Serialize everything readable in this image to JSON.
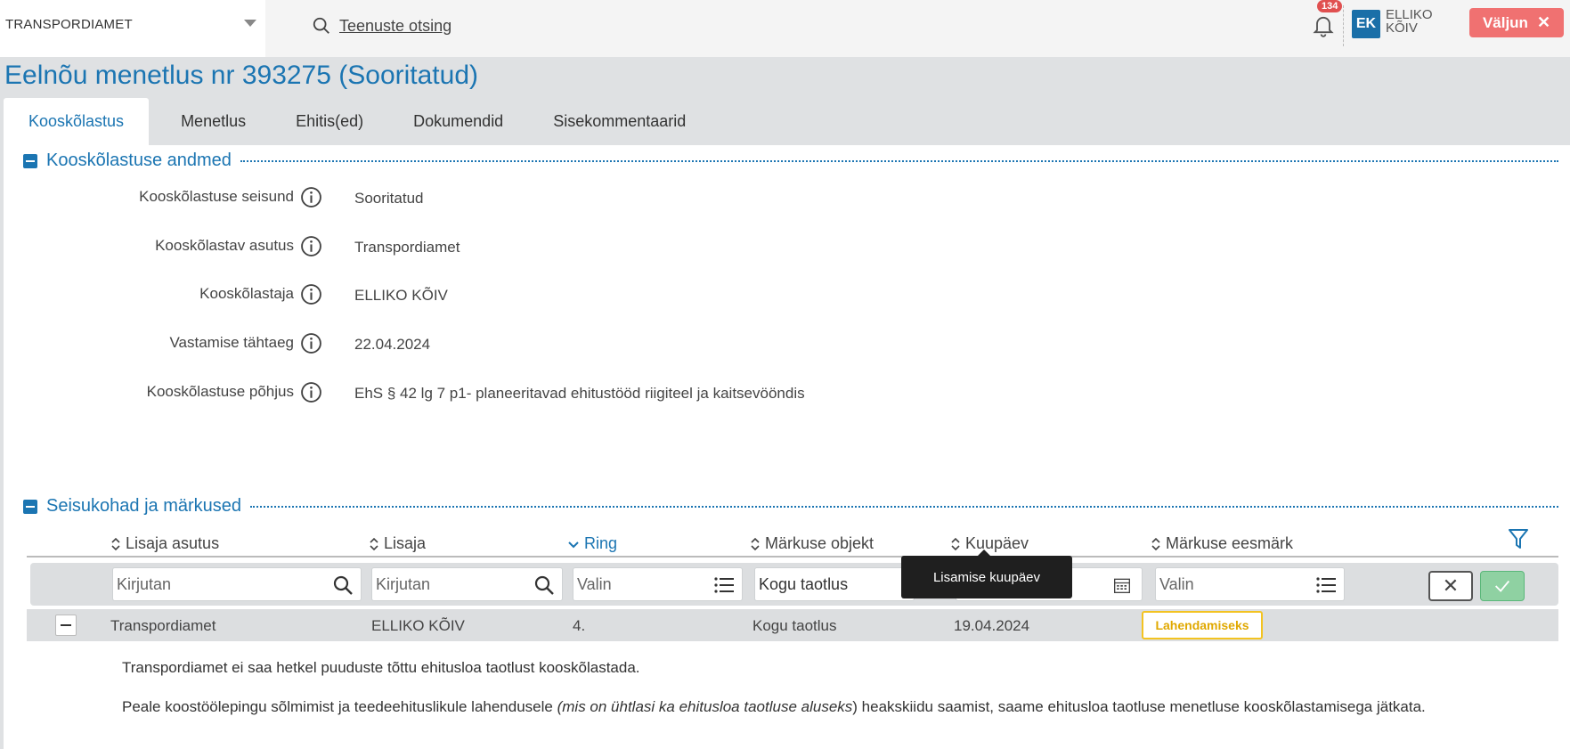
{
  "topbar": {
    "org_select": "TRANSPORDIAMET",
    "search_label": "Teenuste otsing",
    "notification_count": "134",
    "avatar_initials": "EK",
    "user_first": "ELLIKO",
    "user_last": "KÕIV",
    "logout_label": "Väljun"
  },
  "page_title": "Eelnõu menetlus nr 393275 (Sooritatud)",
  "tabs": [
    "Kooskõlastus",
    "Menetlus",
    "Ehitis(ed)",
    "Dokumendid",
    "Sisekommentaarid"
  ],
  "section1": {
    "title": "Kooskõlastuse andmed",
    "fields": [
      {
        "label": "Kooskõlastuse seisund",
        "value": "Sooritatud"
      },
      {
        "label": "Kooskõlastav asutus",
        "value": "Transpordiamet"
      },
      {
        "label": "Kooskõlastaja",
        "value": "ELLIKO KÕIV"
      },
      {
        "label": "Vastamise tähtaeg",
        "value": "22.04.2024"
      },
      {
        "label": "Kooskõlastuse põhjus",
        "value": "EhS § 42 lg 7 p1- planeeritavad ehitustööd riigiteel ja kaitsevööndis"
      }
    ]
  },
  "section2": {
    "title": "Seisukohad ja märkused",
    "columns": [
      "Lisaja asutus",
      "Lisaja",
      "Ring",
      "Märkuse objekt",
      "Kuupäev",
      "Märkuse eesmärk"
    ],
    "filters": {
      "lisaja_asutus": "Kirjutan",
      "lisaja": "Kirjutan",
      "ring": "Valin",
      "objekt": "Kogu taotlus",
      "eesmark": "Valin"
    },
    "tooltip": "Lisamise kuupäev",
    "row": {
      "asutus": "Transpordiamet",
      "lisaja": "ELLIKO KÕIV",
      "ring": "4.",
      "objekt": "Kogu taotlus",
      "kuupaev": "19.04.2024",
      "eesmark": "Lahendamiseks"
    },
    "comment_line1": "Transpordiamet ei saa hetkel puuduste tõttu ehitusloa taotlust kooskõlastada.",
    "comment_line2_a": "Peale koostöölepingu sõlmimist ja teedeehituslikule lahendusele ",
    "comment_line2_b": "(mis on ühtlasi ka ehitusloa taotluse aluseks",
    "comment_line2_c": ") heakskiidu saamist, saame ehitusloa taotluse menetluse kooskõlastamisega jätkata."
  },
  "colors": {
    "accent": "#1b75b2",
    "logout": "#f07171",
    "badge": "#f3c321",
    "apply": "#8fd1a2"
  }
}
